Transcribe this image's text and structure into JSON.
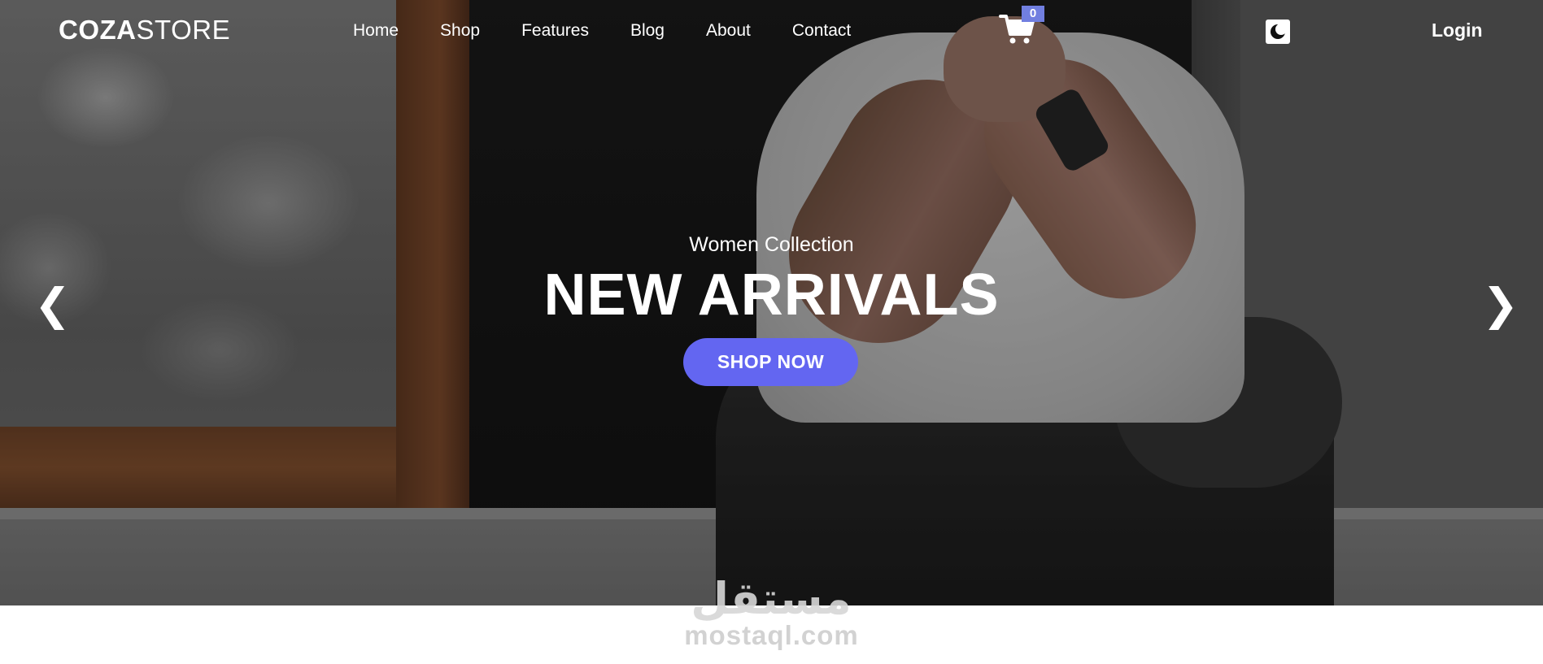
{
  "brand": {
    "bold": "COZA",
    "light": "STORE"
  },
  "nav": {
    "items": [
      "Home",
      "Shop",
      "Features",
      "Blog",
      "About",
      "Contact"
    ]
  },
  "cart": {
    "count": "0",
    "icon": "cart-icon"
  },
  "theme_toggle": {
    "icon": "moon-icon"
  },
  "login": {
    "label": "Login"
  },
  "hero": {
    "subtitle": "Women Collection",
    "headline": "NEW ARRIVALS",
    "cta": "SHOP NOW",
    "prev_glyph": "❮",
    "next_glyph": "❯"
  },
  "watermark": {
    "logo_text": "مستقل",
    "text": "mostaql.com"
  },
  "colors": {
    "accent": "#6366f1",
    "badge": "#717fe0",
    "overlay": "rgba(0,0,0,0.35)"
  }
}
